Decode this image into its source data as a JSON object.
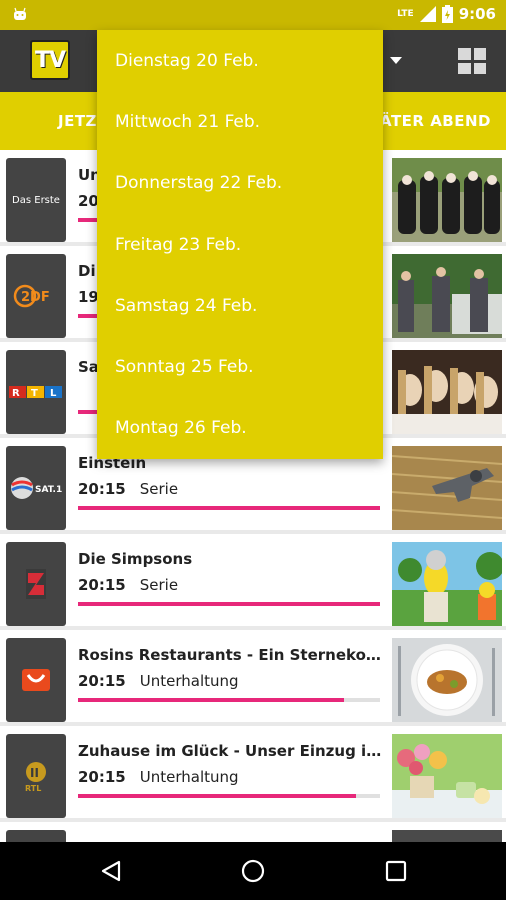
{
  "status_bar": {
    "time": "9:06",
    "network": "LTE"
  },
  "app_bar": {
    "logo_text": "TV",
    "accent": "#e0cf00"
  },
  "tabs": {
    "left": "JETZT",
    "right": "ÄTER ABEND"
  },
  "date_menu": {
    "items": [
      "Dienstag 20 Feb.",
      "Mittwoch 21 Feb.",
      "Donnerstag 22 Feb.",
      "Freitag 23 Feb.",
      "Samstag 24 Feb.",
      "Sonntag 25 Feb.",
      "Montag 26 Feb."
    ]
  },
  "programs": [
    {
      "channel": "Das Erste",
      "title": "Un",
      "time": "20",
      "genre": "",
      "progress": 0.98
    },
    {
      "channel": "ZDF",
      "title": "Di",
      "time": "19",
      "genre": "",
      "progress": 0.98
    },
    {
      "channel": "RTL",
      "title": "Sa",
      "time": "",
      "genre": "",
      "progress": 0.98
    },
    {
      "channel": "SAT.1",
      "title": "Einstein",
      "time": "20:15",
      "genre": "Serie",
      "progress": 1.0
    },
    {
      "channel": "ProSieben",
      "title": "Die Simpsons",
      "time": "20:15",
      "genre": "Serie",
      "progress": 1.0
    },
    {
      "channel": "kabel eins",
      "title": "Rosins Restaurants - Ein Sternekoch hilft",
      "time": "20:15",
      "genre": "Unterhaltung",
      "progress": 0.88
    },
    {
      "channel": "RTL II",
      "title": "Zuhause im Glück - Unser Einzug in ein neues Leben",
      "time": "20:15",
      "genre": "Unterhaltung",
      "progress": 0.92
    }
  ]
}
